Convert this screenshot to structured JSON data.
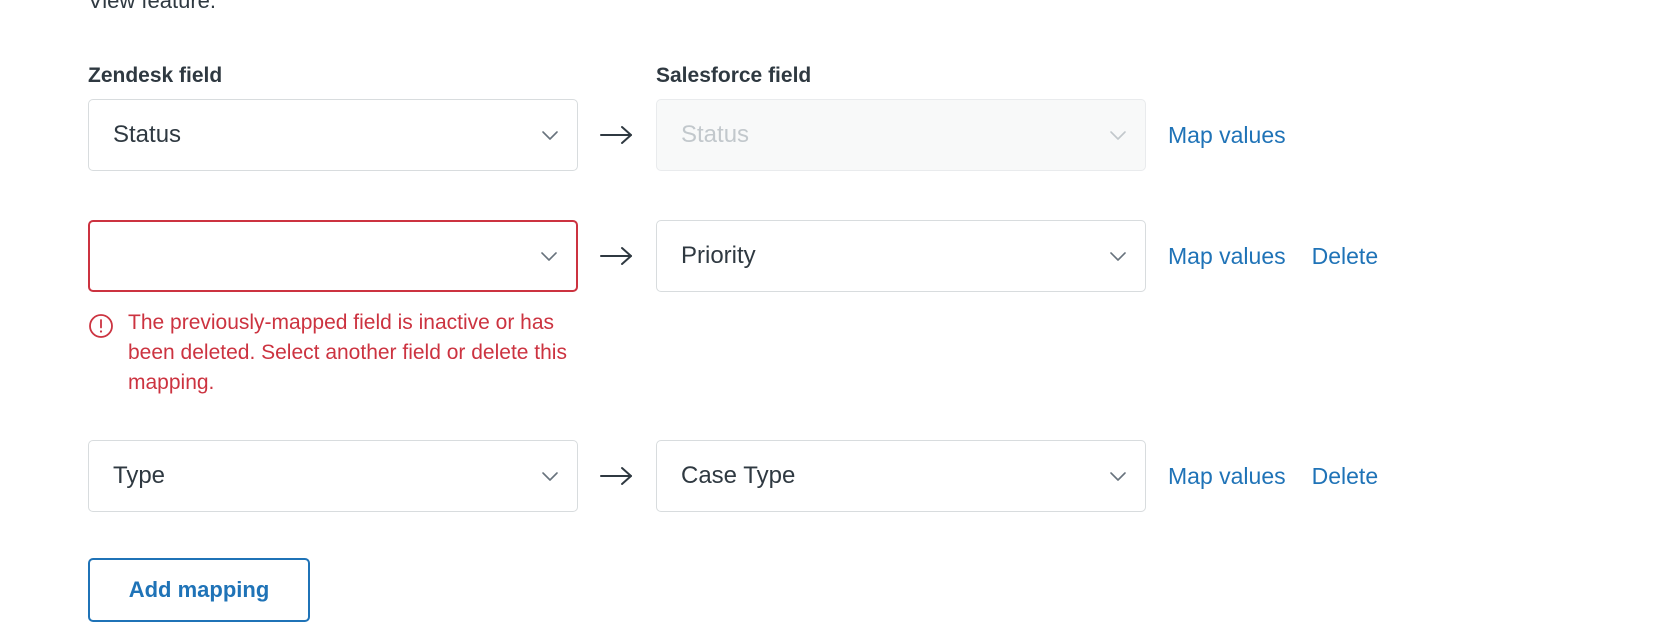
{
  "intro": {
    "text": "View feature."
  },
  "columns": {
    "zendesk_label": "Zendesk field",
    "salesforce_label": "Salesforce field"
  },
  "colors": {
    "link": "#1f73b7",
    "error": "#cc3340",
    "text": "#2f3941",
    "border": "#d8dcde",
    "disabled_bg": "#f8f9f9",
    "disabled_text": "#c2c8cc"
  },
  "icons": {
    "chevron": "chevron-down-icon",
    "arrow": "arrow-right-icon",
    "error": "alert-error-icon"
  },
  "rows": [
    {
      "zendesk_value": "Status",
      "zendesk_disabled": false,
      "zendesk_invalid": false,
      "salesforce_value": "Status",
      "salesforce_disabled": true,
      "map_values_label": "Map values",
      "delete_label": ""
    },
    {
      "zendesk_value": "",
      "zendesk_disabled": false,
      "zendesk_invalid": true,
      "salesforce_value": "Priority",
      "salesforce_disabled": false,
      "map_values_label": "Map values",
      "delete_label": "Delete"
    },
    {
      "zendesk_value": "Type",
      "zendesk_disabled": false,
      "zendesk_invalid": false,
      "salesforce_value": "Case Type",
      "salesforce_disabled": false,
      "map_values_label": "Map values",
      "delete_label": "Delete"
    }
  ],
  "error": {
    "message": "The previously-mapped field is inactive or has been deleted. Select another field or delete this mapping."
  },
  "add_button": {
    "label": "Add mapping"
  }
}
